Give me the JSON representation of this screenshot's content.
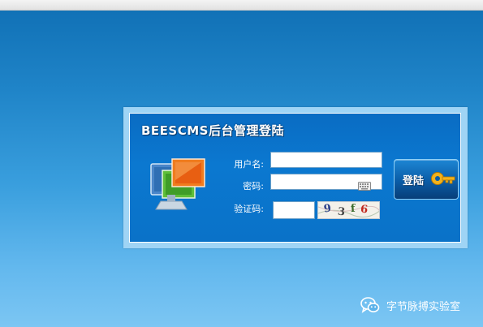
{
  "panel": {
    "title": "BEESCMS后台管理登陆"
  },
  "form": {
    "username_label": "用户名:",
    "username_value": "",
    "password_label": "密码:",
    "password_value": "",
    "captcha_label": "验证码:",
    "captcha_value": "",
    "captcha_chars": [
      "9",
      "3",
      "f",
      "6"
    ],
    "login_label": "登陆"
  },
  "watermark": {
    "text": "字节脉搏实验室"
  },
  "icons": {
    "panel_art": "monitor-windows-icon",
    "password_extra": "keyboard-icon",
    "login_extra": "key-icon",
    "watermark": "wechat-icon"
  },
  "colors": {
    "panel_blue": "#0b78d0",
    "frame_light": "#9fd4f5",
    "key_gold": "#f2b21b"
  }
}
